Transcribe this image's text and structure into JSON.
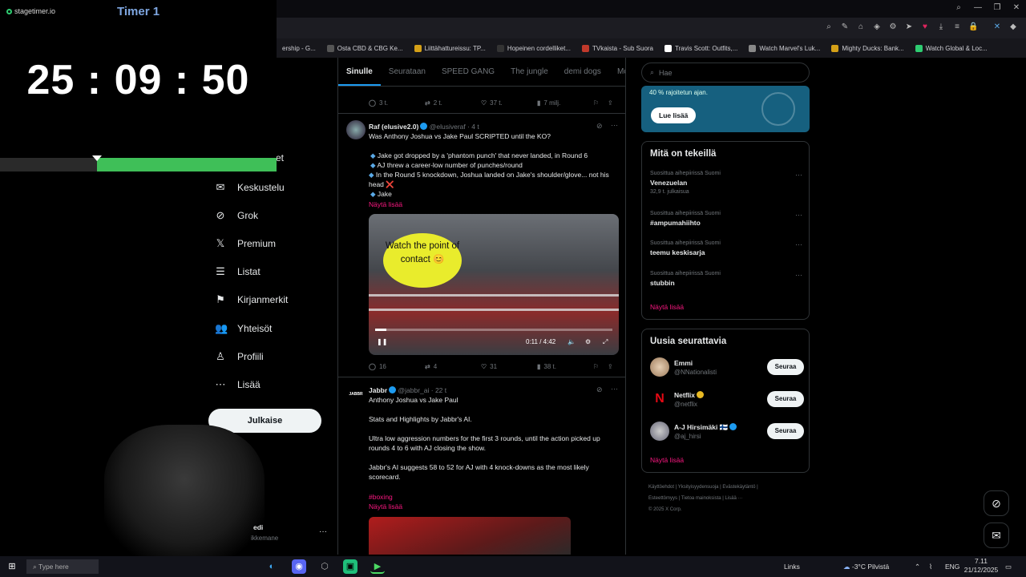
{
  "timer": {
    "app_name": "stagetimer.io",
    "title": "Timer 1",
    "time": "25 : 09 : 50",
    "progress_fraction": 0.65
  },
  "bookmarks": [
    {
      "label": "ership - G..."
    },
    {
      "label": "Osta CBD & CBG Ke..."
    },
    {
      "label": "Liittähattureissu: TP..."
    },
    {
      "label": "Hopeinen cordelliket..."
    },
    {
      "label": "TVkaista - Sub Suora"
    },
    {
      "label": "Travis Scott: Outfits,..."
    },
    {
      "label": "Watch Marvel's Luk..."
    },
    {
      "label": "Mighty Ducks: Bank..."
    },
    {
      "label": "Watch Global & Loc..."
    }
  ],
  "nav": {
    "partial_item": "et",
    "items": [
      {
        "label": "Keskustelu",
        "icon": "mail-icon"
      },
      {
        "label": "Grok",
        "icon": "grok-icon"
      },
      {
        "label": "Premium",
        "icon": "x-icon"
      },
      {
        "label": "Listat",
        "icon": "list-icon"
      },
      {
        "label": "Kirjanmerkit",
        "icon": "bookmark-icon"
      },
      {
        "label": "Yhteisöt",
        "icon": "communities-icon"
      },
      {
        "label": "Profiili",
        "icon": "profile-icon"
      },
      {
        "label": "Lisää",
        "icon": "more-icon"
      }
    ],
    "post_button": "Julkaise",
    "account_name": "edi",
    "account_handle": "ikkemane"
  },
  "tabs": [
    "Sinulle",
    "Seurataan",
    "SPEED GANG",
    "The jungle",
    "demi dogs",
    "McDonal"
  ],
  "top_actions": {
    "replies": "3 t.",
    "reposts": "2 t.",
    "likes": "37 t.",
    "views": "7 milj."
  },
  "post1": {
    "name": "Raf (elusive2.0)",
    "handle": "@elusiveraf · 4 t",
    "text": "Was Anthony Joshua vs Jake Paul SCRIPTED until the KO?",
    "bullets": [
      "Jake got dropped by a 'phantom punch' that never landed, in Round 6",
      "AJ threw a career-low number of punches/round",
      "In the Round 5 knockdown, Joshua landed on Jake's shoulder/glove... not his head ❌",
      "Jake"
    ],
    "show_more": "Näytä lisää",
    "video_bubble": "Watch the point of contact 😊",
    "video_time": "0:11 / 4:42",
    "replies": "16",
    "reposts": "4",
    "likes": "31",
    "views": "38 t."
  },
  "post2": {
    "name": "Jabbr",
    "handle": "@jabbr_ai · 22 t",
    "avatar_text": "JABBR",
    "line1": "Anthony Joshua vs Jake Paul",
    "line2": "Stats and Highlights by Jabbr's AI.",
    "line3": "Ultra low aggression numbers for the first 3 rounds, until the action picked up rounds 4 to 6 with AJ closing the show.",
    "line4": "Jabbr's AI suggests 58 to 52 for AJ with 4 knock-downs as the most likely scorecard.",
    "hashtag": "#boxing",
    "show_more": "Näytä lisää"
  },
  "search": {
    "placeholder": "Hae"
  },
  "promo": {
    "text": "40 % rajoitetun ajan.",
    "button": "Lue lisää"
  },
  "trends": {
    "title": "Mitä on tekeillä",
    "items": [
      {
        "category": "Suosittua aihepiirissä Suomi",
        "name": "Venezuelan",
        "count": "32,9 t. julkaisua"
      },
      {
        "category": "Suosittua aihepiirissä Suomi",
        "name": "#ampumahiihto",
        "count": ""
      },
      {
        "category": "Suosittua aihepiirissä Suomi",
        "name": "teemu keskisarja",
        "count": ""
      },
      {
        "category": "Suosittua aihepiirissä Suomi",
        "name": "stubbin",
        "count": ""
      }
    ],
    "show_more": "Näytä lisää"
  },
  "who_to_follow": {
    "title": "Uusia seurattavia",
    "items": [
      {
        "name": "Emmi",
        "handle": "@NNationalisti",
        "button": "Seuraa"
      },
      {
        "name": "Netflix",
        "handle": "@netflix",
        "button": "Seuraa"
      },
      {
        "name": "A-J Hirsimäki 🇫🇮",
        "handle": "@aj_hirsi",
        "button": "Seuraa"
      }
    ],
    "show_more": "Näytä lisää"
  },
  "footer": {
    "row1": "Käyttöehdot | Yksityisyydensuoja | Evästekäytäntö |",
    "row2": "Esteettömyys | Tietoa mainoksista | Lisää ···",
    "row3": "© 2025 X Corp."
  },
  "taskbar": {
    "search_placeholder": "Type here",
    "links": "Links",
    "weather": "-3°C Pilvistä",
    "lang": "ENG",
    "time": "7.11",
    "date": "21/12/2025"
  }
}
